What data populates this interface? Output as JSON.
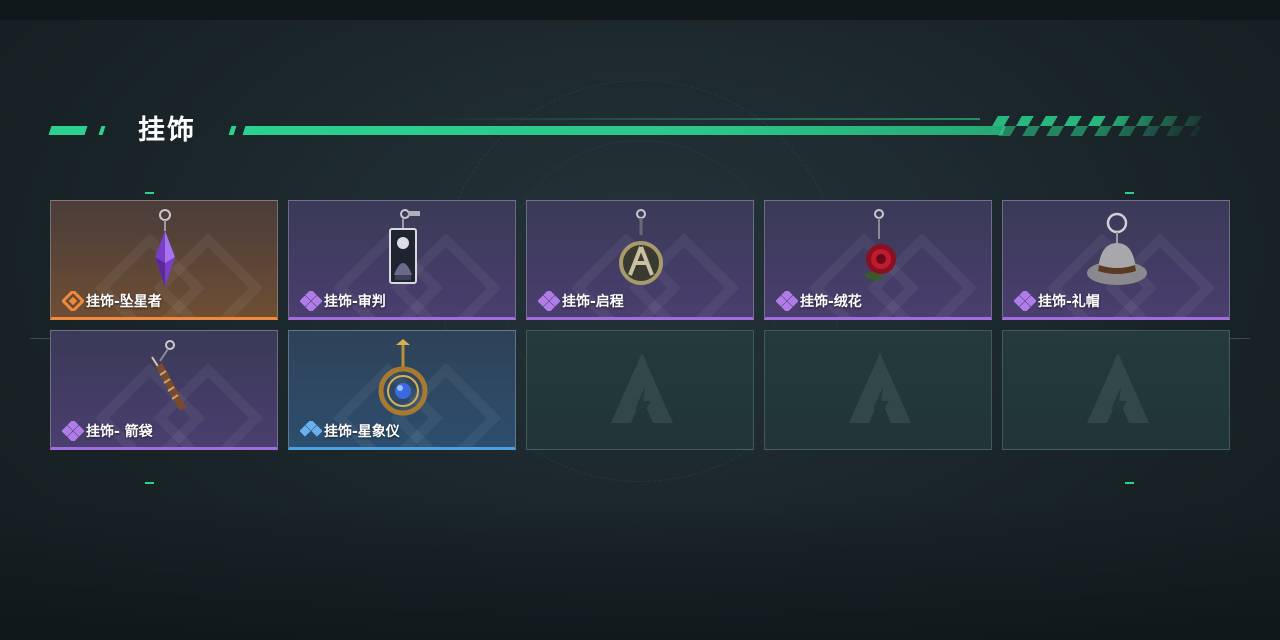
{
  "section": {
    "title": "挂饰"
  },
  "colors": {
    "accent": "#2bd18e",
    "rarity_orange": "#f0893b",
    "rarity_purple": "#a36ddd",
    "rarity_blue": "#4fa0e0"
  },
  "items": [
    {
      "name": "挂饰-坠星者",
      "rarity": "orange",
      "icon": "purple-crystal-pendant-icon"
    },
    {
      "name": "挂饰-审判",
      "rarity": "purple",
      "icon": "tarot-card-pendant-icon"
    },
    {
      "name": "挂饰-启程",
      "rarity": "purple",
      "icon": "bronze-emblem-pendant-icon"
    },
    {
      "name": "挂饰-绒花",
      "rarity": "purple",
      "icon": "red-rose-pendant-icon"
    },
    {
      "name": "挂饰-礼帽",
      "rarity": "purple",
      "icon": "grey-top-hat-pendant-icon"
    },
    {
      "name": "挂饰- 箭袋",
      "rarity": "purple",
      "icon": "arrow-quiver-pendant-icon"
    },
    {
      "name": "挂饰-星象仪",
      "rarity": "blue",
      "icon": "astrolabe-pendant-icon"
    }
  ],
  "empty_slots": 3,
  "empty_slot_icon": "lightning-a-logo-icon"
}
